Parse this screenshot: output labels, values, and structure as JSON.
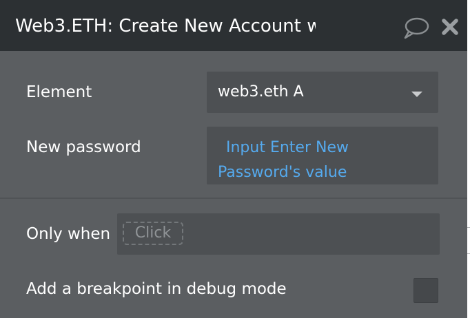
{
  "header": {
    "title": "Web3.ETH: Create New Account w",
    "icons": [
      "comment-icon",
      "close-icon"
    ]
  },
  "fields": {
    "element": {
      "label": "Element",
      "value": "web3.eth A",
      "icon": "caret-down-icon"
    },
    "new_password": {
      "label": "New password",
      "value_line1": "Input Enter New",
      "value_line2": "Password's value"
    },
    "only_when": {
      "label": "Only when",
      "placeholder": "Click"
    },
    "breakpoint": {
      "label": "Add a breakpoint in debug mode",
      "checked": false
    }
  },
  "colors": {
    "header_bg": "#2c3033",
    "panel_bg": "#5b5e61",
    "field_bg": "#4d5053",
    "dynamic_text": "#55aaee"
  }
}
